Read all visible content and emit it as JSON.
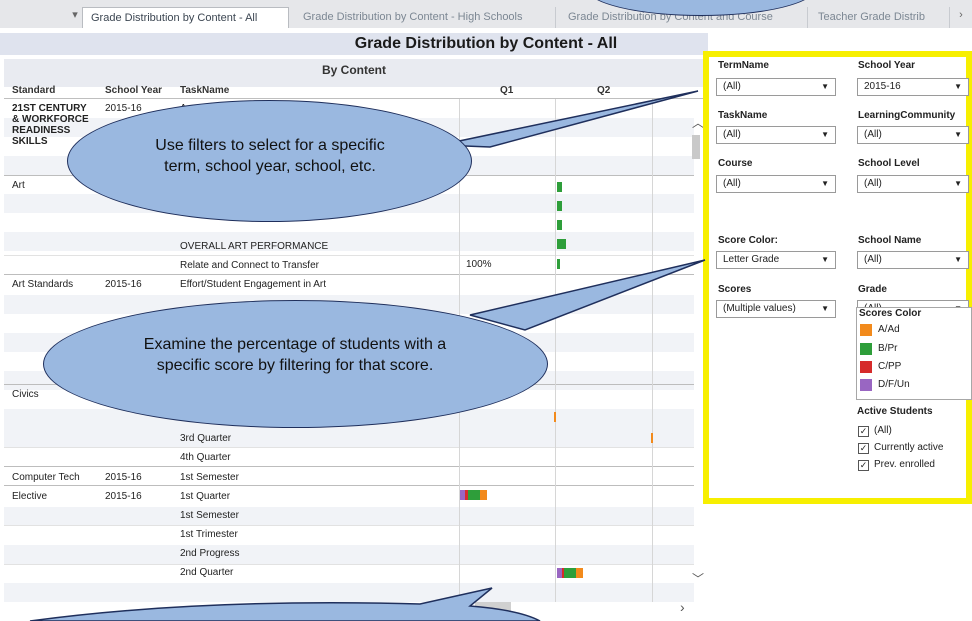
{
  "tabs": [
    "Grade Distribution by Content - All",
    "Grade Distribution by Content - High Schools",
    "Grade Distribution by Content and Course",
    "Teacher Grade Distrib"
  ],
  "nav": {
    "down": "▾",
    "left": "‹",
    "right": "›"
  },
  "page_title": "Grade Distribution by Content - All",
  "viz": {
    "subtitle": "By Content",
    "columns": {
      "standard": "Standard",
      "school_year": "School Year",
      "taskname": "TaskName",
      "q1": "Q1",
      "q2": "Q2"
    },
    "rows": [
      {
        "standard": "21ST CENTURY & WORKFORCE READINESS SKILLS",
        "year": "2015-16",
        "task": "A",
        "pct": ""
      },
      {
        "standard": "Art",
        "year": "2015-16",
        "task": "",
        "pct": ""
      },
      {
        "task": "OVERALL ART PERFORMANCE",
        "pct": ""
      },
      {
        "task": "Relate and Connect to Transfer",
        "pct": "100%"
      },
      {
        "standard": "Art Standards",
        "year": "2015-16",
        "task": "Effort/Student Engagement in Art",
        "pct": ""
      },
      {
        "standard": "Civics",
        "year": "",
        "task": "",
        "pct": ""
      },
      {
        "task": "3rd Quarter",
        "pct": ""
      },
      {
        "task": "4th Quarter",
        "pct": ""
      },
      {
        "standard": "Computer Tech",
        "year": "2015-16",
        "task": "1st Semester",
        "pct": ""
      },
      {
        "standard": "Elective",
        "year": "2015-16",
        "task": "1st Quarter",
        "pct": ""
      },
      {
        "task": "1st Semester",
        "pct": ""
      },
      {
        "task": "1st Trimester",
        "pct": ""
      },
      {
        "task": "2nd Progress",
        "pct": ""
      },
      {
        "task": "2nd Quarter",
        "pct": ""
      }
    ]
  },
  "filters": {
    "termname": {
      "label": "TermName",
      "value": "(All)"
    },
    "school_year": {
      "label": "School Year",
      "value": "2015-16"
    },
    "taskname": {
      "label": "TaskName",
      "value": "(All)"
    },
    "learning_community": {
      "label": "LearningCommunity",
      "value": "(All)"
    },
    "course": {
      "label": "Course",
      "value": "(All)"
    },
    "school_level": {
      "label": "School Level",
      "value": "(All)"
    },
    "score_color": {
      "label": "Score Color:",
      "value": "Letter Grade"
    },
    "school_name": {
      "label": "School Name",
      "value": "(All)"
    },
    "scores": {
      "label": "Scores",
      "value": "(Multiple values)"
    },
    "grade": {
      "label": "Grade",
      "value": "(All)"
    }
  },
  "legend": {
    "title": "Scores Color",
    "items": [
      {
        "label": "A/Ad",
        "color": "#f28a1c"
      },
      {
        "label": "B/Pr",
        "color": "#2e9e3a"
      },
      {
        "label": "C/PP",
        "color": "#d62b2b"
      },
      {
        "label": "D/F/Un",
        "color": "#9966c2"
      }
    ]
  },
  "active_students": {
    "title": "Active Students",
    "items": [
      "(All)",
      "Currently active",
      "Prev. enrolled"
    ],
    "check": "✓"
  },
  "callouts": {
    "filters": "Use filters to select for a specific term, school year, school, etc.",
    "scores": "Examine the percentage of students with a specific score by filtering for that score."
  }
}
